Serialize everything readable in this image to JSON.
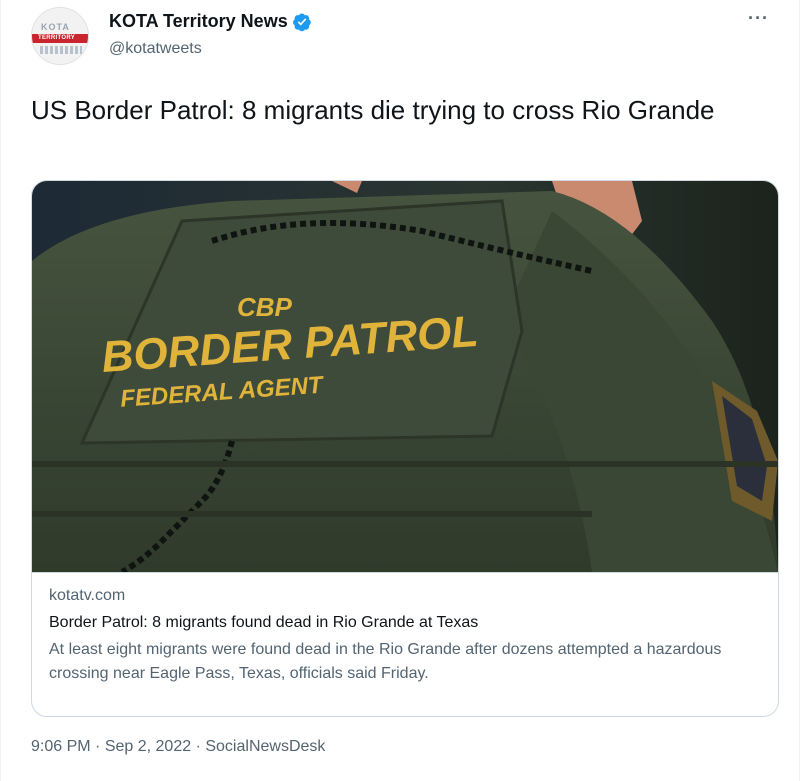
{
  "author": {
    "name": "KOTA Territory News",
    "handle": "@kotatweets",
    "verified": true,
    "avatar_logo_text": "TERRITORY"
  },
  "menu": {
    "more_label": "···"
  },
  "tweet": {
    "text": "US Border Patrol: 8 migrants die trying to cross Rio Grande"
  },
  "card": {
    "image": {
      "patch_line1": "CBP",
      "patch_line2": "BORDER PATROL",
      "patch_line3": "FEDERAL AGENT"
    },
    "domain": "kotatv.com",
    "title": "Border Patrol: 8 migrants found dead in Rio Grande at Texas",
    "description": "At least eight migrants were found dead in the Rio Grande after dozens attempted a hazardous crossing near Eagle Pass, Texas, officials said Friday."
  },
  "footer": {
    "time": "9:06 PM",
    "separator": "·",
    "date": "Sep 2, 2022",
    "source": "SocialNewsDesk"
  },
  "colors": {
    "verified_badge": "#1d9bf0",
    "secondary_text": "#536471",
    "patch_text": "#e0b43a",
    "uniform_green": "#3c4a37"
  }
}
